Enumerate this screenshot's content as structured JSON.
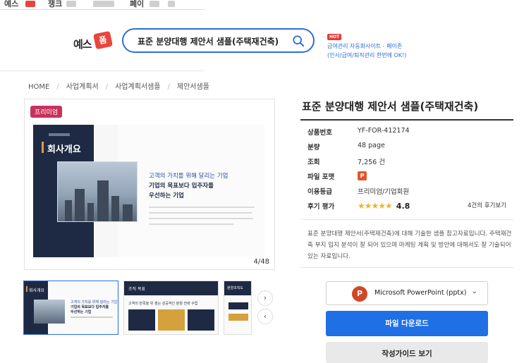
{
  "top_nav": {
    "items": [
      "예스",
      "쟁크",
      "폐이"
    ]
  },
  "logo": {
    "text": "예스",
    "tag": "폼"
  },
  "search": {
    "query": "표준 분양대행 제안서 샘플(주택재건축)"
  },
  "ad": {
    "badge": "HOT",
    "line1": "급여관리 자동화사이트 - 페이존",
    "line2": "(인사/급여/퇴직관리 한번에 OK!)"
  },
  "breadcrumb": [
    "HOME",
    "사업계획서",
    "사업계획서샘플",
    "제안서샘플"
  ],
  "preview": {
    "badge": "프리미엄",
    "page_counter": "4/48",
    "slide": {
      "heading": "회사개요",
      "line1": "고객의 가치를 위해 달리는 기업",
      "line2": "기업의 목표보다 입주자를",
      "line3": "우선하는 기업"
    }
  },
  "thumbs": [
    {
      "heading": "회사개요",
      "text1": "고객의 가치를 위해 달리는 기업",
      "text2": "기업의 목표보다 입주자를",
      "text3": "우선하는 기업"
    },
    {
      "heading": "조직 목표",
      "text1": "고객의 만족을 위 점는 성공적인 분양 전략 수립"
    },
    {
      "heading": "분양조직도"
    }
  ],
  "thumb_nav": {
    "next": "›",
    "prev": "‹"
  },
  "product": {
    "title": "표준 분양대행 제안서 샘플(주택재건축)",
    "info": [
      {
        "key": "상품번호",
        "value": "YF-FOR-412174"
      },
      {
        "key": "분량",
        "value": "48 page"
      },
      {
        "key": "조회",
        "value": "7,256 건"
      },
      {
        "key": "파일 포맷",
        "value": "P"
      },
      {
        "key": "이용등급",
        "value": "프리미엄/기업회원"
      }
    ],
    "rating": {
      "key": "후기 평가",
      "stars": "★★★★★",
      "score": "4.8",
      "reviews": "4건의 후기보기"
    },
    "description": "표준 분양대행 제안서(주택재건축)에 대해 기술한 샘플 참고자료입니다. 주택재건축 부지 입지 분석이 잘 되어 있으며 마케팅 계획 및 방안에 대해서도 잘 기술되어 있는 자료입니다."
  },
  "file_select": {
    "icon_letter": "P",
    "value": "Microsoft PowerPoint (pptx)",
    "chevron": "⌄"
  },
  "buttons": {
    "download": "파일 다운로드",
    "guide": "작성가이드 보기"
  },
  "colors": {
    "accent": "#1f6fe5",
    "premium": "#c8325a",
    "navy": "#1e2a44",
    "gold": "#d4a13d"
  }
}
